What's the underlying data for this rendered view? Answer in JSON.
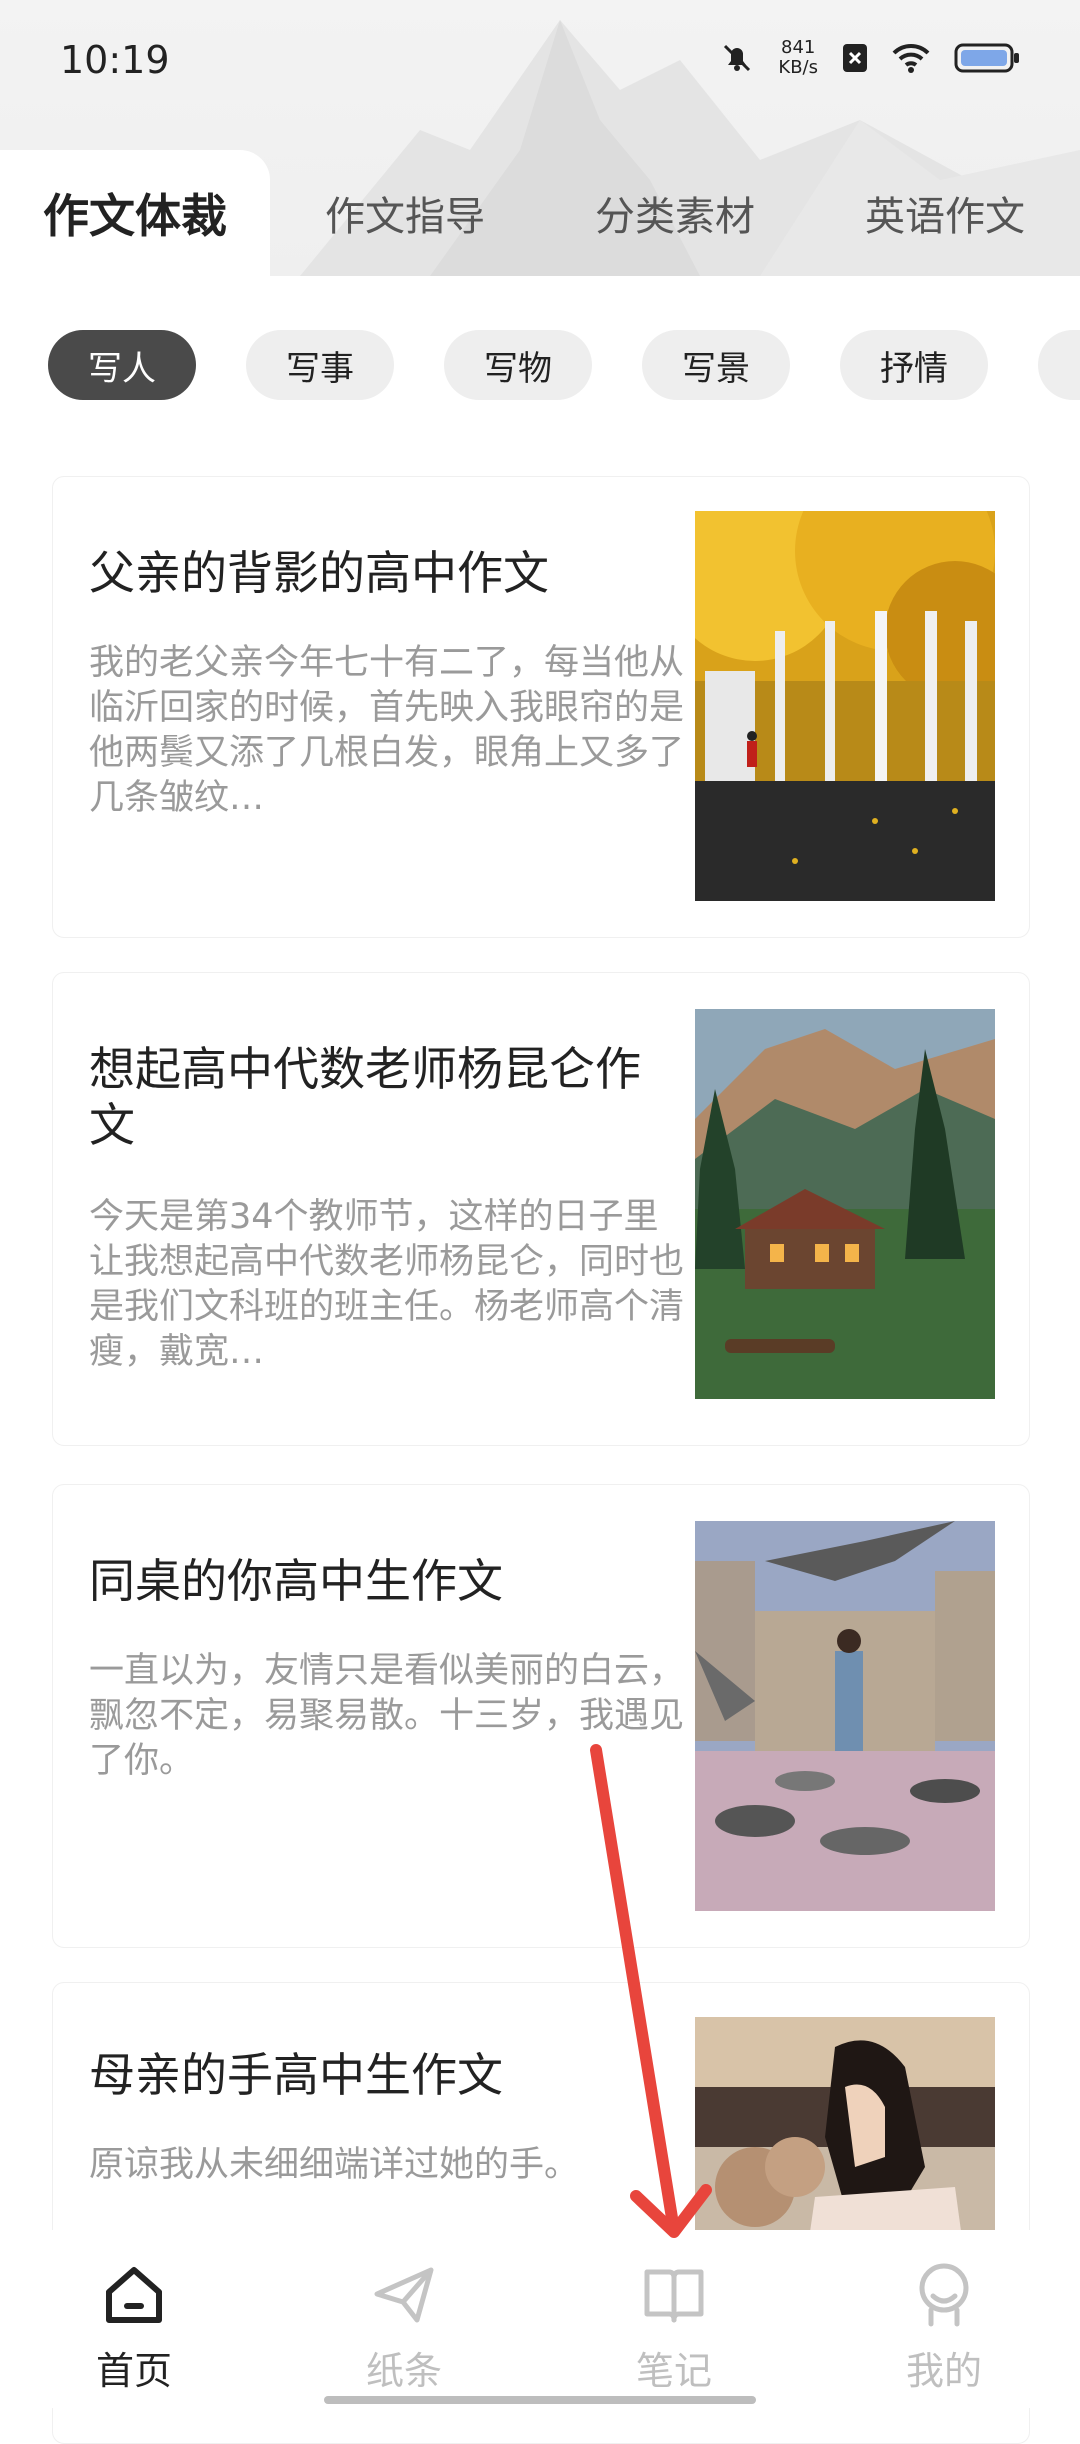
{
  "status_bar": {
    "time": "10:19",
    "net_speed_value": "841",
    "net_speed_unit": "KB/s",
    "icons": [
      "mute-bell-icon",
      "close-box-icon",
      "wifi-icon",
      "battery-icon"
    ]
  },
  "top_tabs": [
    {
      "label": "作文体裁",
      "active": true
    },
    {
      "label": "作文指导",
      "active": false
    },
    {
      "label": "分类素材",
      "active": false
    },
    {
      "label": "英语作文",
      "active": false
    }
  ],
  "categories": [
    {
      "label": "写人",
      "active": true
    },
    {
      "label": "写事",
      "active": false
    },
    {
      "label": "写物",
      "active": false
    },
    {
      "label": "写景",
      "active": false
    },
    {
      "label": "抒情",
      "active": false
    }
  ],
  "articles": [
    {
      "title": "父亲的背影的高中作文",
      "excerpt": "我的老父亲今年七十有二了，每当他从临沂回家的时候，首先映入我眼帘的是他两鬓又添了几根白发，眼角上又多了几条皱纹…",
      "image": "autumn-trees-street"
    },
    {
      "title": "想起高中代数老师杨昆仑作文",
      "excerpt": "今天是第34个教师节，这样的日子里让我想起高中代数老师杨昆仑，同时也是我们文科班的班主任。杨老师高个清瘦，戴宽…",
      "image": "mountain-cabin"
    },
    {
      "title": "同桌的你高中生作文",
      "excerpt": "一直以为，友情只是看似美丽的白云，飘忽不定，易聚易散。十三岁，我遇见了你。",
      "image": "woman-with-pigeons"
    },
    {
      "title": "母亲的手高中生作文",
      "excerpt": "原谅我从未细细端详过她的手。",
      "image": "woman-with-flowers"
    }
  ],
  "bottom_nav": [
    {
      "label": "首页",
      "icon": "home-icon",
      "active": true
    },
    {
      "label": "纸条",
      "icon": "paper-plane-icon",
      "active": false
    },
    {
      "label": "笔记",
      "icon": "book-icon",
      "active": false
    },
    {
      "label": "我的",
      "icon": "profile-icon",
      "active": false
    }
  ],
  "colors": {
    "accent_dark": "#4a4a4a",
    "annotation_arrow": "#e8453c",
    "muted_text": "#9a9a9a"
  }
}
